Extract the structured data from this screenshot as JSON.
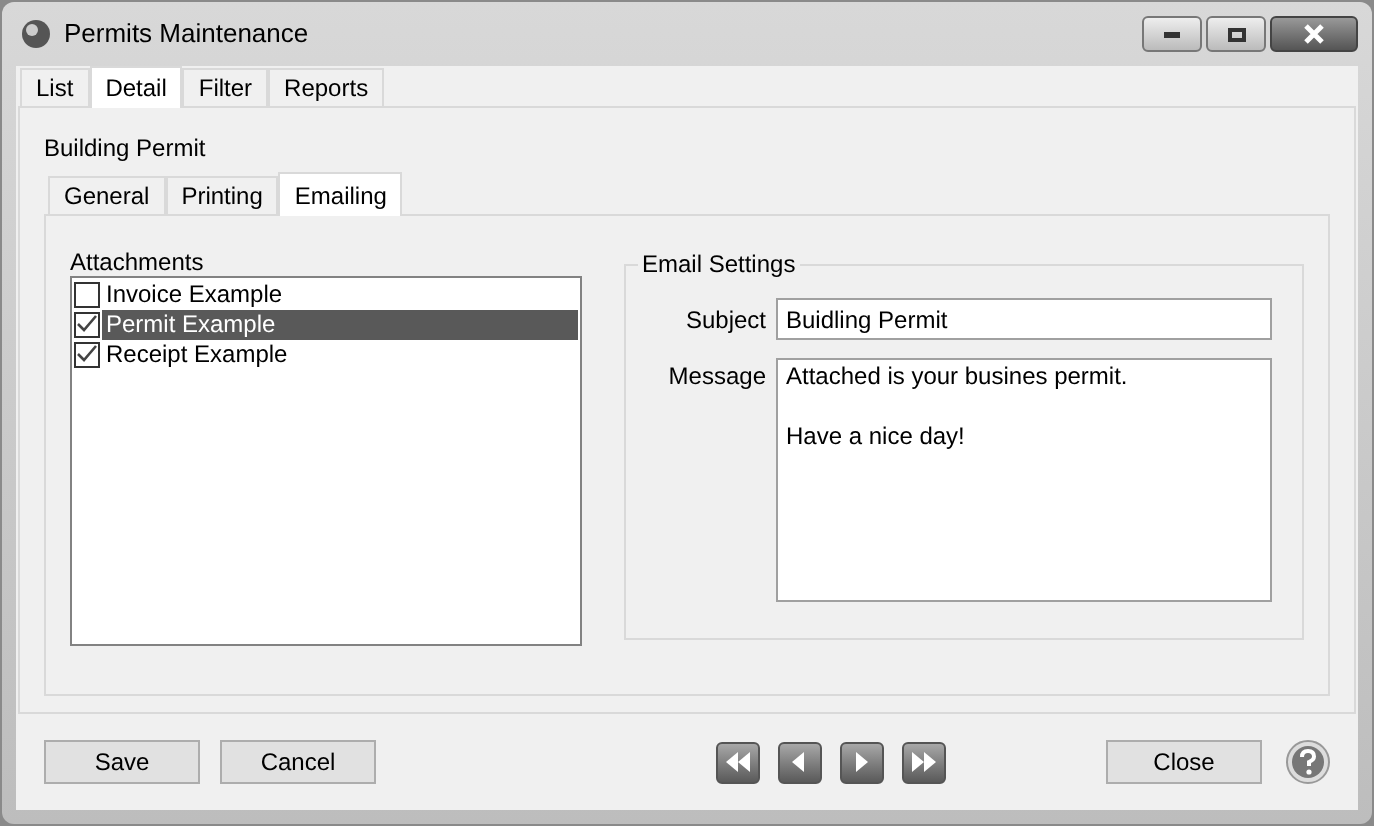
{
  "window": {
    "title": "Permits Maintenance"
  },
  "tabs": [
    {
      "label": "List",
      "selected": false
    },
    {
      "label": "Detail",
      "selected": true
    },
    {
      "label": "Filter",
      "selected": false
    },
    {
      "label": "Reports",
      "selected": false
    }
  ],
  "record_title": "Building Permit",
  "subtabs": [
    {
      "label": "General",
      "selected": false
    },
    {
      "label": "Printing",
      "selected": false
    },
    {
      "label": "Emailing",
      "selected": true
    }
  ],
  "attachments": {
    "label": "Attachments",
    "items": [
      {
        "label": "Invoice Example",
        "checked": false,
        "selected": false
      },
      {
        "label": "Permit Example",
        "checked": true,
        "selected": true
      },
      {
        "label": "Receipt Example",
        "checked": true,
        "selected": false
      }
    ]
  },
  "email_settings": {
    "title": "Email Settings",
    "subject_label": "Subject",
    "subject": "Buidling Permit",
    "message_label": "Message",
    "message": "Attached is your busines permit.\n\nHave a nice day!"
  },
  "buttons": {
    "save": "Save",
    "cancel": "Cancel",
    "close": "Close"
  }
}
